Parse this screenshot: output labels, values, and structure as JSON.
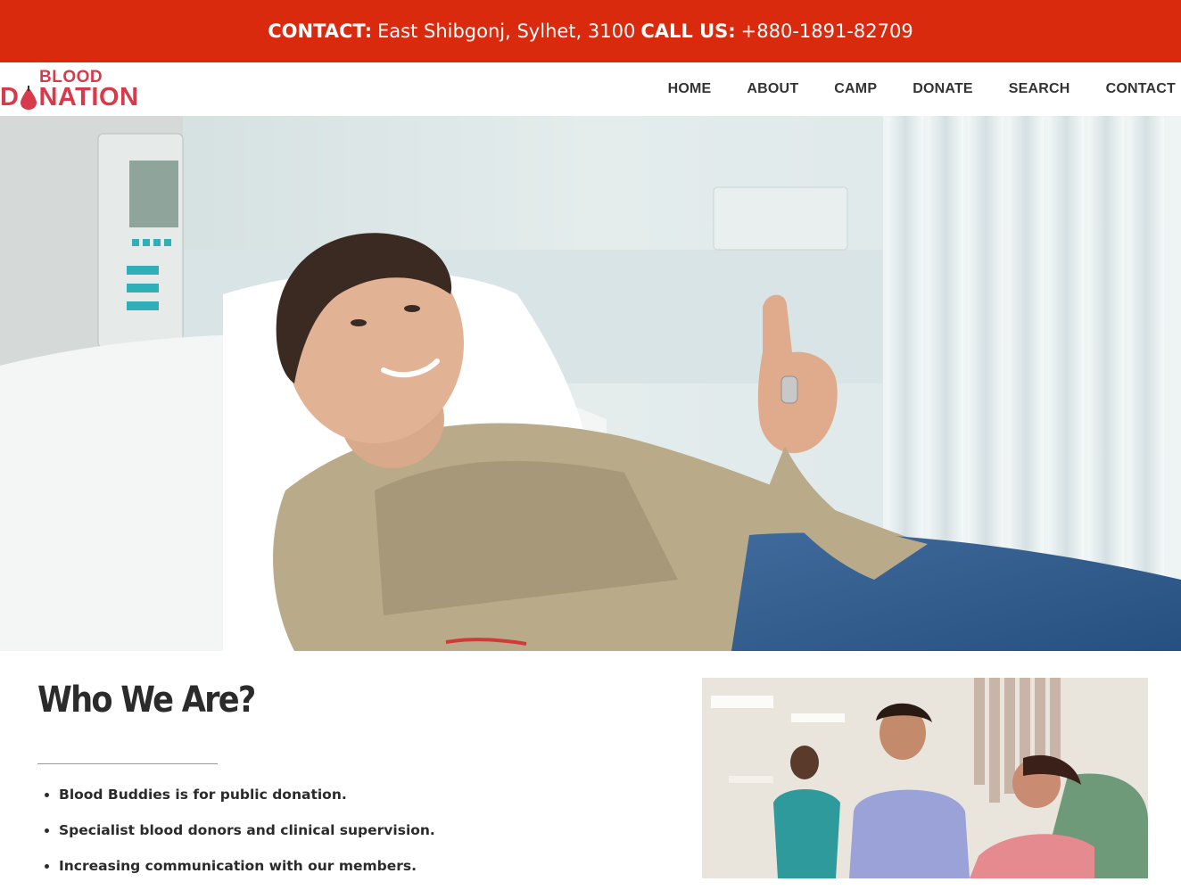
{
  "topbar": {
    "contact_label": "CONTACT:",
    "contact_address": "East Shibgonj, Sylhet, 3100",
    "call_label": "CALL US:",
    "call_number": "+880-1891-82709"
  },
  "logo": {
    "line1": "BLOOD",
    "line2_prefix": "D",
    "line2_suffix": "NATION"
  },
  "nav": {
    "items": [
      "HOME",
      "ABOUT",
      "CAMP",
      "DONATE",
      "SEARCH",
      "CONTACT"
    ]
  },
  "about": {
    "title": "Who We Are?",
    "features": [
      "Blood Buddies is for public donation.",
      "Specialist blood donors and clinical supervision.",
      "Increasing communication with our members."
    ]
  },
  "colors": {
    "topbar_bg": "#d92a0e",
    "brand_red": "#d73a4a",
    "text_dark": "#2b2b2b"
  }
}
